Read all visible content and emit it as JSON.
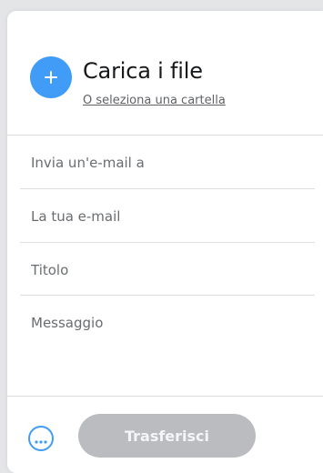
{
  "colors": {
    "accent": "#409cf6",
    "disabled_button": "#babcc0"
  },
  "upload": {
    "add_icon": "plus-icon",
    "title": "Carica i file",
    "folder_link": "O seleziona una cartella"
  },
  "form": {
    "recipient_placeholder": "Invia un'e-mail a",
    "sender_placeholder": "La tua e-mail",
    "title_placeholder": "Titolo",
    "message_placeholder": "Messaggio"
  },
  "footer": {
    "more_icon": "more-options-icon",
    "transfer_label": "Trasferisci"
  }
}
